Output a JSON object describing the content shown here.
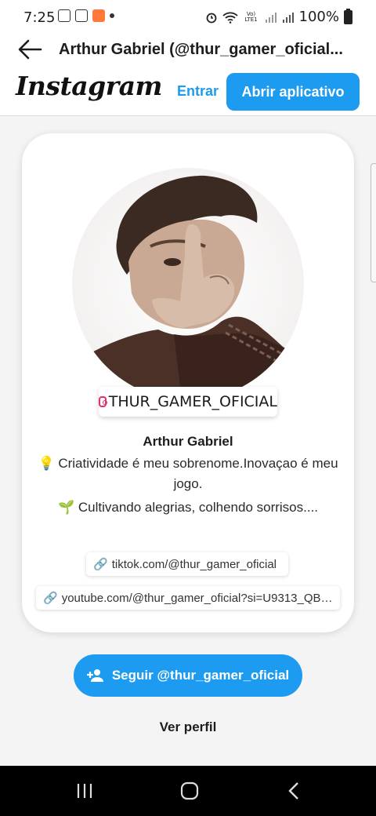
{
  "status_bar": {
    "time": "7:25",
    "battery": "100%",
    "network": "Vo) LTE1"
  },
  "appbar": {
    "title": "Arthur Gabriel (@thur_gamer_oficial..."
  },
  "header": {
    "logo": "Instagram",
    "login": "Entrar",
    "open_app": "Abrir aplicativo"
  },
  "profile": {
    "handle": "THUR_GAMER_OFICIAL",
    "name": "Arthur Gabriel",
    "bio": [
      "💡 Criatividade é meu sobrenome.Inovaçao é meu jogo.",
      "🌱 Cultivando alegrias, colhendo sorrisos...."
    ],
    "links": [
      "tiktok.com/@thur_gamer_oficial",
      "youtube.com/@thur_gamer_oficial?si=U9313_QBj..."
    ]
  },
  "actions": {
    "follow": "Seguir @thur_gamer_oficial",
    "view_profile": "Ver perfil"
  },
  "colors": {
    "accent": "#1d9bf0",
    "instagram_pink": "#e1306c"
  }
}
